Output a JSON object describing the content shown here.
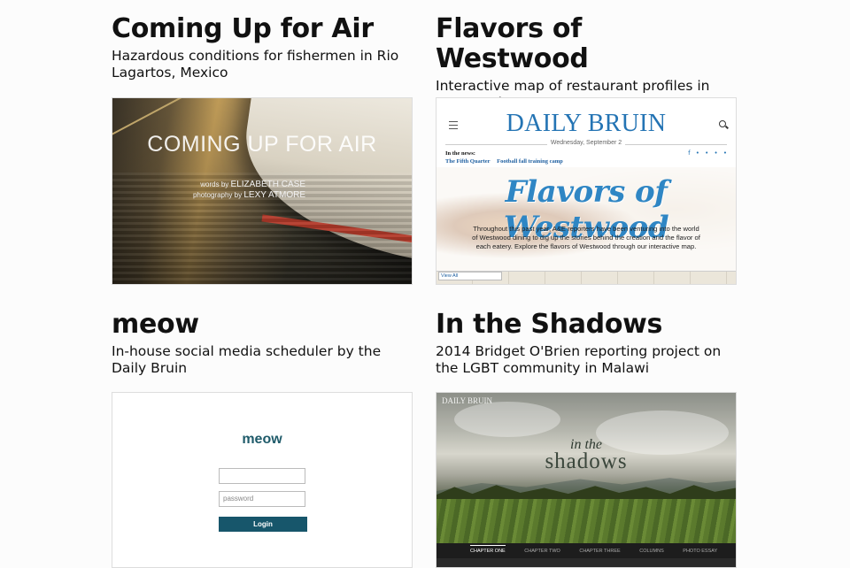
{
  "projects": [
    {
      "title": "Coming Up for Air",
      "description": "Hazardous conditions for fishermen in Rio Lagartos, Mexico",
      "thumbnail": {
        "headline": "COMING UP FOR AIR",
        "credit_line1_prefix": "words by",
        "credit_line1_name": "ELIZABETH CASE",
        "credit_line2_prefix": "photography by",
        "credit_line2_name": "LEXY ATMORE"
      }
    },
    {
      "title": "Flavors of Westwood",
      "description": "Interactive map of restaurant profiles in Los Angeles",
      "thumbnail": {
        "masthead": "DAILY BRUIN",
        "date": "Wednesday, September 2",
        "news_label": "In the news:",
        "news_links": [
          "The Fifth Quarter",
          "Football fall training camp"
        ],
        "social": "f • • • •",
        "script_title": "Flavors of Westwood",
        "blurb": "Throughout this past year, A&E reporters have been venturing into the world of Westwood dining to dig up the stories behind the creation and the flavor of each eatery. Explore the flavors of Westwood through our interactive map.",
        "view_all": "View All"
      }
    },
    {
      "title": "meow",
      "description": "In-house social media scheduler by the Daily Bruin",
      "thumbnail": {
        "logo": "meow",
        "username_placeholder": "",
        "password_placeholder": "password",
        "login_label": "Login",
        "brand_color": "#17566b"
      }
    },
    {
      "title": "In the Shadows",
      "description": "2014 Bridget O'Brien reporting project on the LGBT community in Malawi",
      "thumbnail": {
        "logo": "DAILY BRUIN",
        "title_small": "in the",
        "title_large": "shadows",
        "nav": [
          "CHAPTER ONE",
          "CHAPTER TWO",
          "CHAPTER THREE",
          "COLUMNS",
          "PHOTO ESSAY"
        ]
      }
    }
  ]
}
